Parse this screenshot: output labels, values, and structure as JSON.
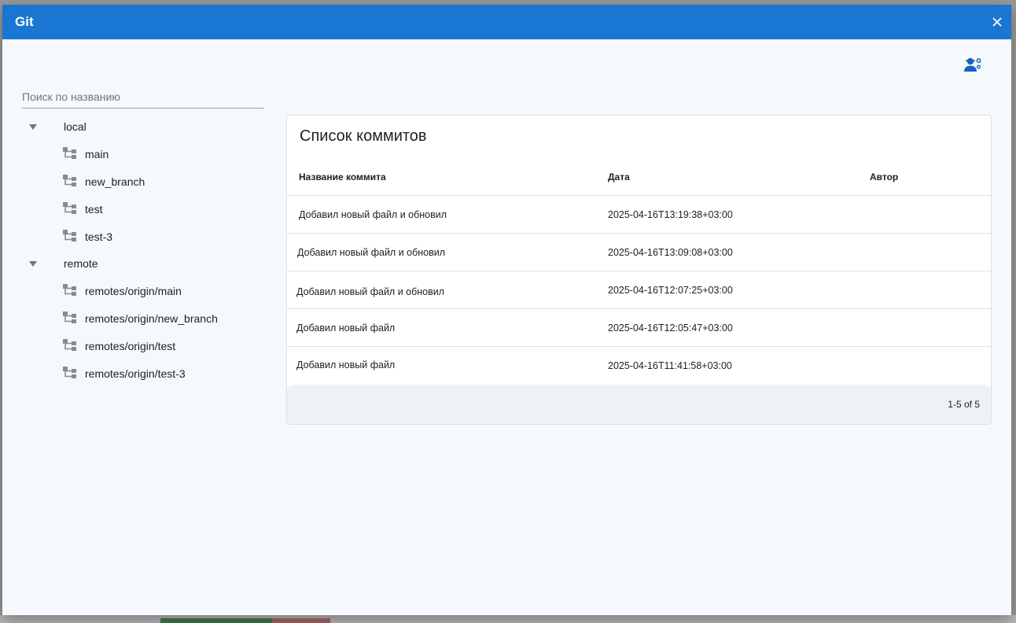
{
  "dialog": {
    "title": "Git",
    "close_icon": "close-icon",
    "user_settings_icon": "user-settings-icon",
    "accent_color": "#1976d2"
  },
  "search": {
    "placeholder": "Поиск по названию",
    "value": ""
  },
  "tree": {
    "groups": [
      {
        "label": "local",
        "expanded": true,
        "branches": [
          "main",
          "new_branch",
          "test",
          "test-3"
        ]
      },
      {
        "label": "remote",
        "expanded": true,
        "branches": [
          "remotes/origin/main",
          "remotes/origin/new_branch",
          "remotes/origin/test",
          "remotes/origin/test-3"
        ]
      }
    ]
  },
  "commits": {
    "title": "Список коммитов",
    "columns": [
      "Название коммита",
      "Дата",
      "Автор"
    ],
    "rows": [
      {
        "name": "Добавил новый файл и обновил",
        "date": "2025-04-16T13:19:38+03:00",
        "author": ""
      },
      {
        "name": "Добавил новый файл и обновил",
        "date": "2025-04-16T13:09:08+03:00",
        "author": ""
      },
      {
        "name": "Добавил новый файл и обновил",
        "date": "2025-04-16T12:07:25+03:00",
        "author": ""
      },
      {
        "name": "Добавил новый файл",
        "date": "2025-04-16T12:05:47+03:00",
        "author": ""
      },
      {
        "name": "Добавил новый файл",
        "date": "2025-04-16T11:41:58+03:00",
        "author": ""
      }
    ],
    "pagination": "1-5 of 5"
  }
}
